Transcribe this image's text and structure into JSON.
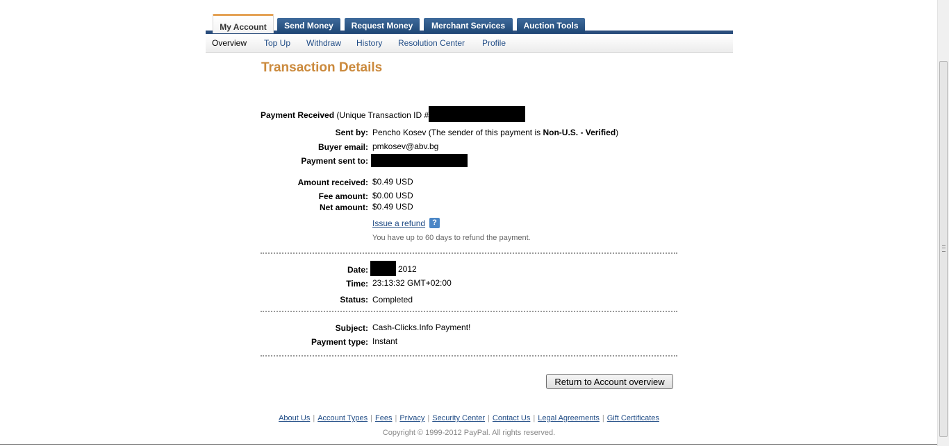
{
  "tabs": [
    {
      "label": "My Account",
      "active": true
    },
    {
      "label": "Send Money"
    },
    {
      "label": "Request Money"
    },
    {
      "label": "Merchant Services"
    },
    {
      "label": "Auction Tools"
    }
  ],
  "subnav": [
    "Overview",
    "Top Up",
    "Withdraw",
    "History",
    "Resolution Center",
    "Profile"
  ],
  "page_title": "Transaction Details",
  "payment": {
    "heading": "Payment Received",
    "txn_prefix": "(Unique Transaction ID #"
  },
  "details": {
    "sent_by_label": "Sent by:",
    "sent_by_name": "Pencho Kosev (The sender of this payment is ",
    "sent_by_status": "Non-U.S. - Verified",
    "sent_by_close": ")",
    "buyer_email_label": "Buyer email:",
    "buyer_email": "pmkosev@abv.bg",
    "sent_to_label": "Payment sent to:",
    "amount_label": "Amount received:",
    "amount": "$0.49 USD",
    "fee_label": "Fee amount:",
    "fee": "$0.00 USD",
    "net_label": "Net amount:",
    "net": "$0.49 USD",
    "refund_link": "Issue a refund",
    "help_icon": "?",
    "refund_note": "You have up to 60 days to refund the payment."
  },
  "date_section": {
    "date_label": "Date:",
    "date_year": "2012",
    "time_label": "Time:",
    "time": "23:13:32 GMT+02:00",
    "status_label": "Status:",
    "status": "Completed"
  },
  "subject_section": {
    "subject_label": "Subject:",
    "subject": "Cash-Clicks.Info Payment!",
    "type_label": "Payment type:",
    "type": "Instant"
  },
  "return_button": "Return to Account overview",
  "footer_links": [
    "About Us",
    "Account Types",
    "Fees",
    "Privacy",
    "Security Center",
    "Contact Us",
    "Legal Agreements",
    "Gift Certificates"
  ],
  "copyright": "Copyright © 1999-2012 PayPal. All rights reserved.",
  "colors": {
    "title": "#cb8a3d",
    "nav_blue": "#2a4d7c",
    "link": "#1f4b85"
  }
}
